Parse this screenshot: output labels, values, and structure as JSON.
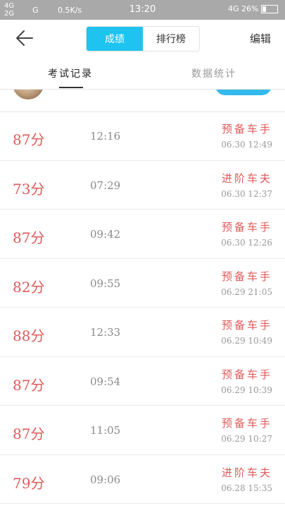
{
  "status_bar": {
    "network_top": "4G",
    "network_bottom": "2G",
    "network_g": "G",
    "speed": "0.5K/s",
    "time": "13:20",
    "right_network": "4G",
    "battery": "26%"
  },
  "header": {
    "back_icon": "arrow-left-icon",
    "segments": [
      {
        "label": "成绩",
        "active": true
      },
      {
        "label": "排行榜",
        "active": false
      }
    ],
    "edit_label": "编辑"
  },
  "tabs": [
    {
      "label": "考试记录",
      "active": true
    },
    {
      "label": "数据统计",
      "active": false
    }
  ],
  "colors": {
    "accent": "#1ec3f0",
    "score": "#e05a5a",
    "statusbar": "#a9a9a9"
  },
  "records": [
    {
      "score": "87分",
      "duration": "12:16",
      "rank": "预备车手",
      "date": "06.30 12:49"
    },
    {
      "score": "73分",
      "duration": "07:29",
      "rank": "进阶车夫",
      "date": "06.30 12:37"
    },
    {
      "score": "87分",
      "duration": "09:42",
      "rank": "预备车手",
      "date": "06.30 12:26"
    },
    {
      "score": "82分",
      "duration": "09:55",
      "rank": "预备车手",
      "date": "06.29 21:05"
    },
    {
      "score": "88分",
      "duration": "12:33",
      "rank": "预备车手",
      "date": "06.29 10:49"
    },
    {
      "score": "87分",
      "duration": "09:54",
      "rank": "预备车手",
      "date": "06.29 10:39"
    },
    {
      "score": "87分",
      "duration": "11:05",
      "rank": "预备车手",
      "date": "06.29 10:27"
    },
    {
      "score": "79分",
      "duration": "09:06",
      "rank": "进阶车夫",
      "date": "06.28 15:35"
    }
  ]
}
